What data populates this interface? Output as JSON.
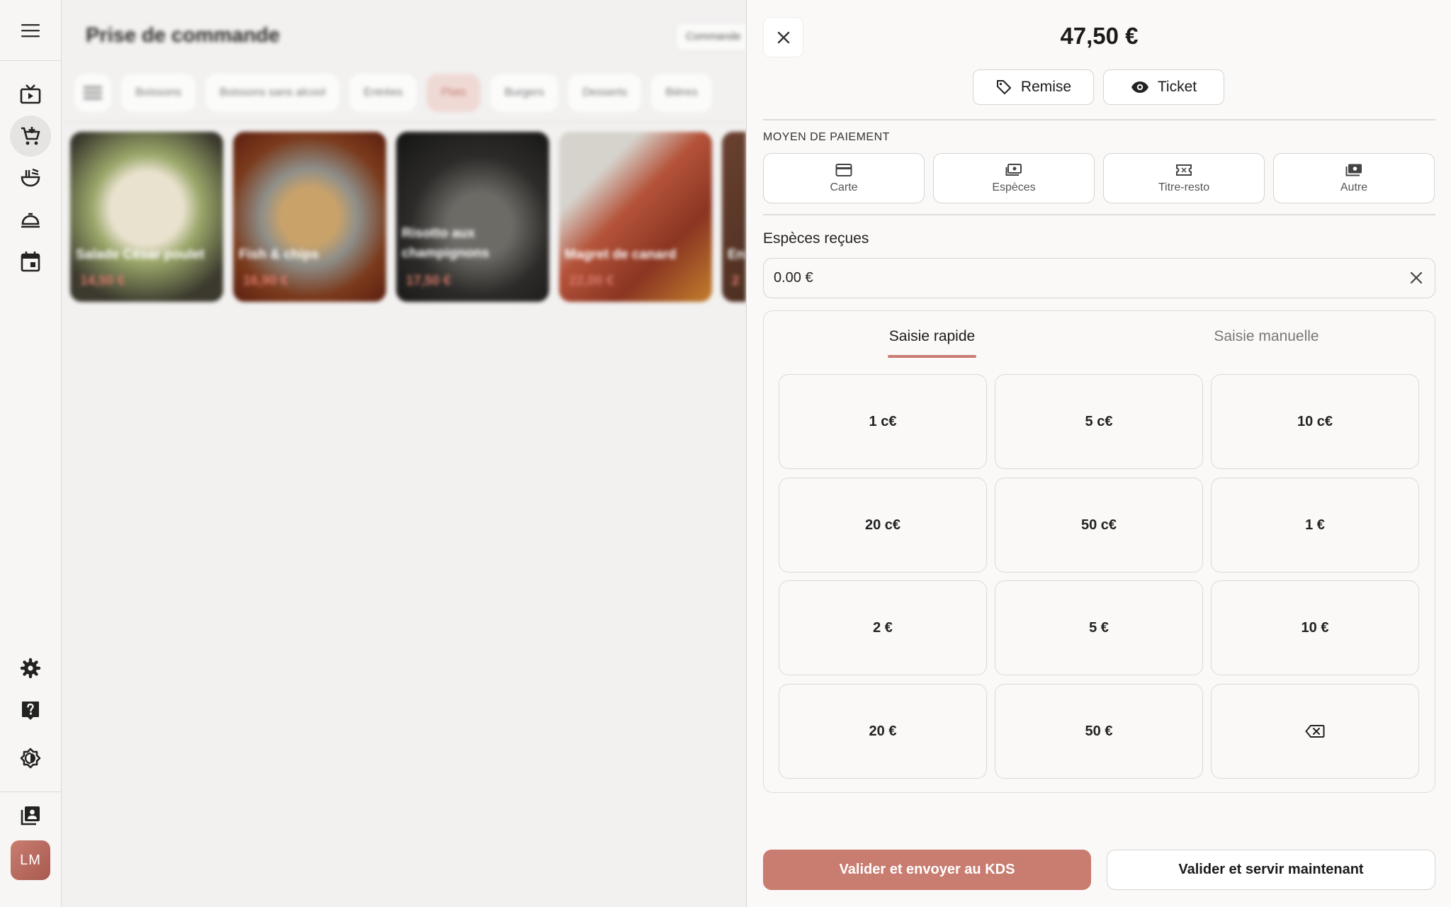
{
  "rail": {
    "items": [
      {
        "icon": "menu-icon"
      },
      {
        "icon": "live-tv-icon"
      },
      {
        "icon": "add-to-cart-icon",
        "active": true
      },
      {
        "icon": "ramen-icon"
      },
      {
        "icon": "room-service-icon"
      },
      {
        "icon": "calendar-icon"
      },
      {
        "icon": "settings-icon"
      },
      {
        "icon": "help-icon"
      },
      {
        "icon": "brightness-icon"
      },
      {
        "icon": "contacts-icon"
      }
    ],
    "avatar_initials": "LM"
  },
  "background": {
    "title": "Prise de commande",
    "command_button": "Commande",
    "categories": [
      "Boissons",
      "Boissons sans alcool",
      "Entrées",
      "Plats",
      "Burgers",
      "Desserts",
      "Bières"
    ],
    "selected_category": "Plats",
    "products": [
      {
        "name": "Salade César poulet",
        "price": "14,50 €"
      },
      {
        "name": "Fish & chips",
        "price": "16,90 €"
      },
      {
        "name": "Risotto aux champignons",
        "price": "17,50 €"
      },
      {
        "name": "Magret de canard",
        "price": "22,00 €"
      },
      {
        "name": "En",
        "price": "2"
      }
    ]
  },
  "panel": {
    "total": "47,50 €",
    "discount_label": "Remise",
    "ticket_label": "Ticket",
    "payment_section_label": "MOYEN DE PAIEMENT",
    "payment_methods": [
      {
        "label": "Carte",
        "icon": "credit-card-icon"
      },
      {
        "label": "Espèces",
        "icon": "cash-icon"
      },
      {
        "label": "Titre-resto",
        "icon": "ticket-icon"
      },
      {
        "label": "Autre",
        "icon": "payments-icon"
      }
    ],
    "cash_field_label": "Espèces reçues",
    "cash_value": "0.00 €",
    "tabs": [
      {
        "label": "Saisie rapide",
        "active": true
      },
      {
        "label": "Saisie manuelle",
        "active": false
      }
    ],
    "keys": [
      "1 c€",
      "5 c€",
      "10 c€",
      "20 c€",
      "50 c€",
      "1 €",
      "2 €",
      "5 €",
      "10 €",
      "20 €",
      "50 €"
    ],
    "backspace_icon": "backspace-icon",
    "primary_action": "Valider et envoyer au KDS",
    "secondary_action": "Valider et servir maintenant"
  },
  "colors": {
    "accent": "#c97c70",
    "panel_bg": "#faf9f8",
    "app_bg": "#f2f1f0"
  }
}
